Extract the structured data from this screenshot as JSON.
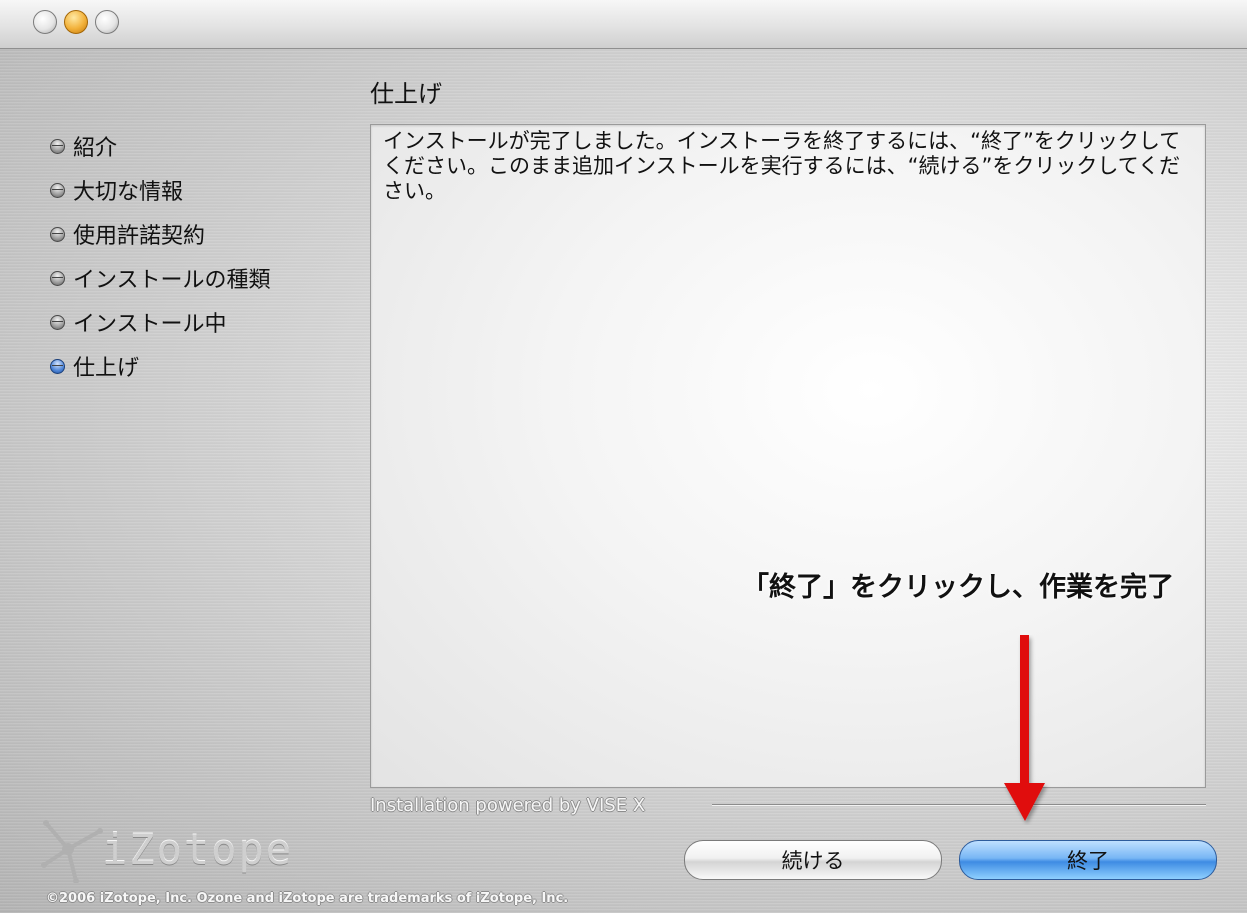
{
  "window": {
    "controls": {
      "close": "close-button",
      "minimize": "minimize-button",
      "zoom": "zoom-button"
    }
  },
  "page_title": "仕上げ",
  "sidebar": {
    "steps": [
      {
        "label": "紹介",
        "active": false
      },
      {
        "label": "大切な情報",
        "active": false
      },
      {
        "label": "使用許諾契約",
        "active": false
      },
      {
        "label": "インストールの種類",
        "active": false
      },
      {
        "label": "インストール中",
        "active": false
      },
      {
        "label": "仕上げ",
        "active": true
      }
    ]
  },
  "content": {
    "message": "インストールが完了しました。インストーラを終了するには、“終了”をクリックしてください。このまま追加インストールを実行するには、“続ける”をクリックしてください。"
  },
  "footer": {
    "powered_by": "Installation powered by VISE X",
    "logo_text": "iZotope",
    "copyright": "©2006 iZotope, Inc. Ozone and iZotope are trademarks of iZotope, Inc."
  },
  "buttons": {
    "continue_label": "続ける",
    "quit_label": "終了"
  },
  "annotation": {
    "text": "「終了」をクリックし、作業を完了",
    "arrow_color": "#e01010"
  },
  "colors": {
    "accent_blue": "#3e8be3",
    "minimize_orange": "#f2b13a"
  }
}
